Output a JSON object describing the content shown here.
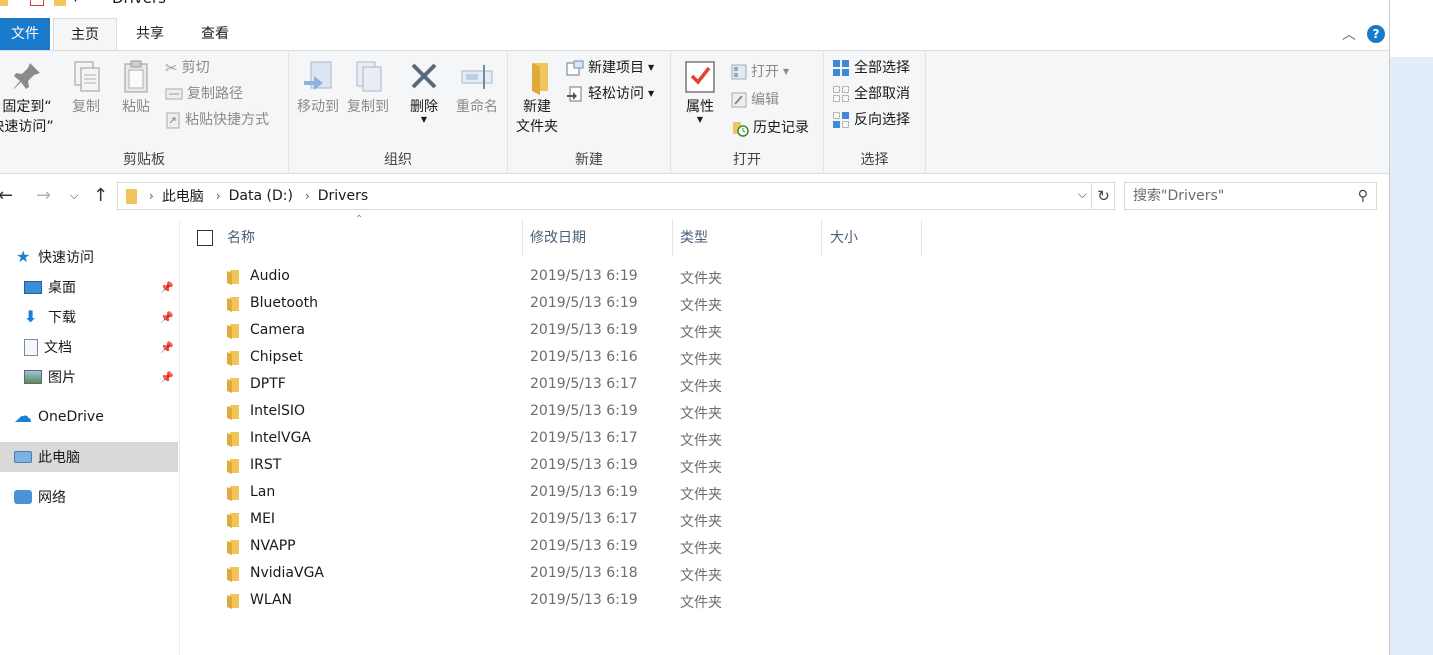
{
  "title_bar": {
    "title": "Drivers"
  },
  "tabs": [
    {
      "label": "文件"
    },
    {
      "label": "主页"
    },
    {
      "label": "共享"
    },
    {
      "label": "查看"
    }
  ],
  "help": {
    "label": "?"
  },
  "ribbon": {
    "clipboard": {
      "group_label": "剪贴板",
      "pin_line1": "固定到“",
      "pin_line2": "快速访问”",
      "copy": "复制",
      "paste": "粘贴",
      "cut": "剪切",
      "copy_path": "复制路径",
      "paste_shortcut": "粘贴快捷方式"
    },
    "organize": {
      "group_label": "组织",
      "move_to": "移动到",
      "copy_to": "复制到",
      "delete": "删除",
      "rename": "重命名"
    },
    "new": {
      "group_label": "新建",
      "new_folder_line1": "新建",
      "new_folder_line2": "文件夹",
      "new_item": "新建项目",
      "easy_access": "轻松访问"
    },
    "open": {
      "group_label": "打开",
      "properties": "属性",
      "open": "打开",
      "edit": "编辑",
      "history": "历史记录"
    },
    "select": {
      "group_label": "选择",
      "select_all": "全部选择",
      "select_none": "全部取消",
      "invert": "反向选择"
    }
  },
  "address": {
    "segments": [
      "此电脑",
      "Data (D:)",
      "Drivers"
    ]
  },
  "search": {
    "placeholder": "搜索\"Drivers\""
  },
  "nav_pane": {
    "quick_access": "快速访问",
    "desktop": "桌面",
    "downloads": "下载",
    "documents": "文档",
    "pictures": "图片",
    "onedrive": "OneDrive",
    "this_pc": "此电脑",
    "network": "网络"
  },
  "columns": {
    "name": "名称",
    "modified": "修改日期",
    "type": "类型",
    "size": "大小"
  },
  "colors": {
    "accent": "#1979ca",
    "folder": "#f2c55c",
    "selected_nav": "#d9d9d9"
  },
  "files": [
    {
      "name": "Audio",
      "modified": "2019/5/13 6:19",
      "type": "文件夹"
    },
    {
      "name": "Bluetooth",
      "modified": "2019/5/13 6:19",
      "type": "文件夹"
    },
    {
      "name": "Camera",
      "modified": "2019/5/13 6:19",
      "type": "文件夹"
    },
    {
      "name": "Chipset",
      "modified": "2019/5/13 6:16",
      "type": "文件夹"
    },
    {
      "name": "DPTF",
      "modified": "2019/5/13 6:17",
      "type": "文件夹"
    },
    {
      "name": "IntelSIO",
      "modified": "2019/5/13 6:19",
      "type": "文件夹"
    },
    {
      "name": "IntelVGA",
      "modified": "2019/5/13 6:17",
      "type": "文件夹"
    },
    {
      "name": "IRST",
      "modified": "2019/5/13 6:19",
      "type": "文件夹"
    },
    {
      "name": "Lan",
      "modified": "2019/5/13 6:19",
      "type": "文件夹"
    },
    {
      "name": "MEI",
      "modified": "2019/5/13 6:17",
      "type": "文件夹"
    },
    {
      "name": "NVAPP",
      "modified": "2019/5/13 6:19",
      "type": "文件夹"
    },
    {
      "name": "NvidiaVGA",
      "modified": "2019/5/13 6:18",
      "type": "文件夹"
    },
    {
      "name": "WLAN",
      "modified": "2019/5/13 6:19",
      "type": "文件夹"
    }
  ]
}
